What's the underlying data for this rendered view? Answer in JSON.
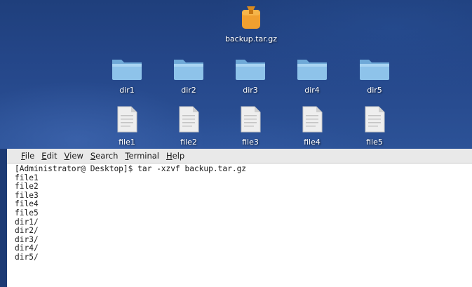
{
  "desktop": {
    "archive": {
      "label": "backup.tar.gz",
      "icon": "archive-icon"
    },
    "folders": [
      {
        "label": "dir1",
        "icon": "folder-icon"
      },
      {
        "label": "dir2",
        "icon": "folder-icon"
      },
      {
        "label": "dir3",
        "icon": "folder-icon"
      },
      {
        "label": "dir4",
        "icon": "folder-icon"
      },
      {
        "label": "dir5",
        "icon": "folder-icon"
      }
    ],
    "files": [
      {
        "label": "file1",
        "icon": "file-icon"
      },
      {
        "label": "file2",
        "icon": "file-icon"
      },
      {
        "label": "file3",
        "icon": "file-icon"
      },
      {
        "label": "file4",
        "icon": "file-icon"
      },
      {
        "label": "file5",
        "icon": "file-icon"
      }
    ]
  },
  "terminal": {
    "menu": [
      {
        "label": "File",
        "mnemonic": "F",
        "rest": "ile"
      },
      {
        "label": "Edit",
        "mnemonic": "E",
        "rest": "dit"
      },
      {
        "label": "View",
        "mnemonic": "V",
        "rest": "iew"
      },
      {
        "label": "Search",
        "mnemonic": "S",
        "rest": "earch"
      },
      {
        "label": "Terminal",
        "mnemonic": "T",
        "rest": "erminal"
      },
      {
        "label": "Help",
        "mnemonic": "H",
        "rest": "elp"
      }
    ],
    "lines": [
      "[Administrator@ Desktop]$ tar -xzvf backup.tar.gz",
      "file1",
      "file2",
      "file3",
      "file4",
      "file5",
      "dir1/",
      "dir2/",
      "dir3/",
      "dir4/",
      "dir5/"
    ]
  },
  "colors": {
    "desktop_bg": "#25478a",
    "folder": "#8ec3ea",
    "archive": "#f0a030",
    "terminal_bg": "#ffffff",
    "menubar_bg": "#e9e9e9"
  }
}
